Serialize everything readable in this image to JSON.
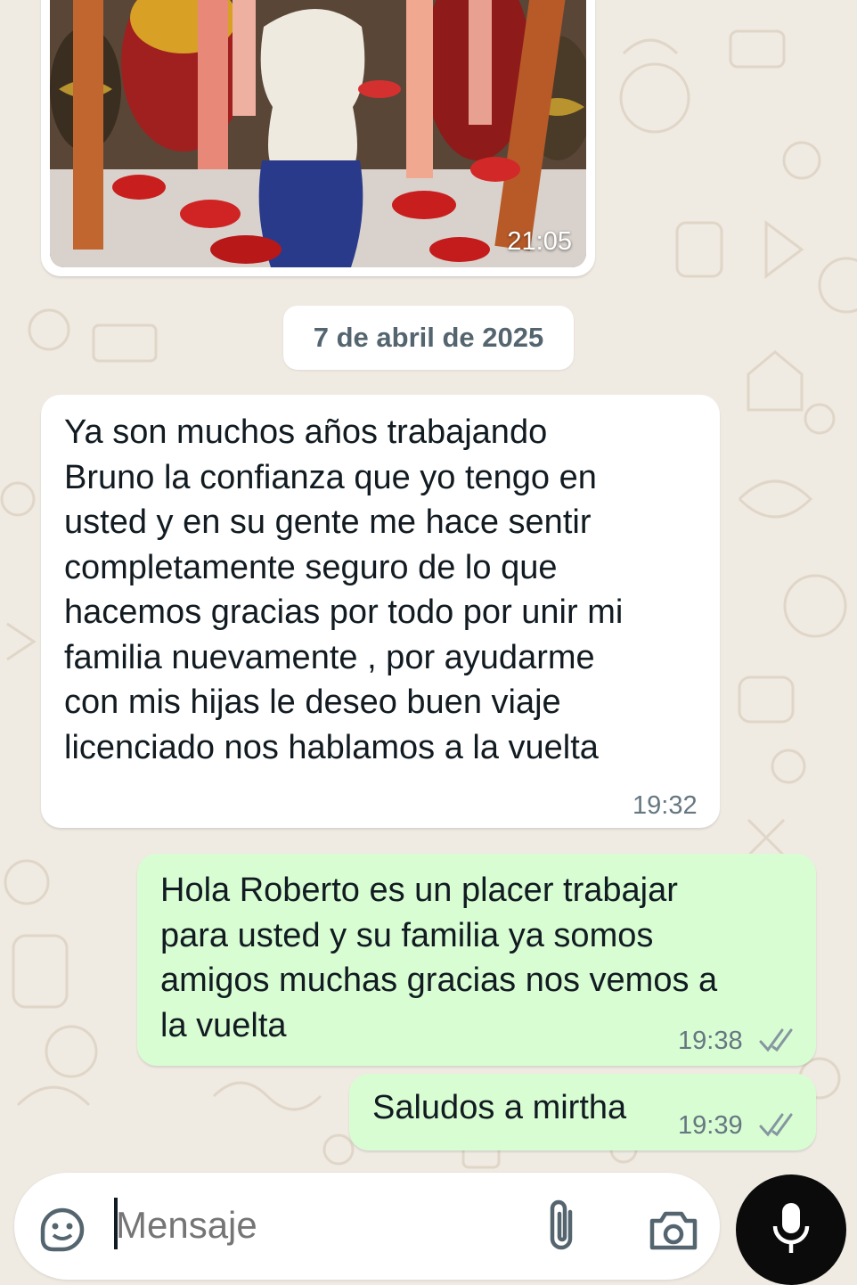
{
  "chat": {
    "image_message": {
      "time": "21:05"
    },
    "date_separator": "7 de abril de 2025",
    "messages": [
      {
        "direction": "incoming",
        "text": "Ya son muchos años trabajando\nBruno la confianza que yo tengo en\nusted y en su gente me hace sentir\ncompletamente seguro de lo que\nhacemos gracias por todo por unir mi\nfamilia nuevamente , por ayudarme\ncon mis hijas le deseo buen viaje\nlicenciado nos hablamos a la vuelta",
        "time": "19:32"
      },
      {
        "direction": "outgoing",
        "text": "Hola Roberto es un placer trabajar\npara usted y su familia ya somos\namigos muchas gracias nos vemos a\nla vuelta",
        "time": "19:38",
        "status": "delivered"
      },
      {
        "direction": "outgoing",
        "text": "Saludos a mirtha",
        "time": "19:39",
        "status": "delivered"
      }
    ]
  },
  "composer": {
    "placeholder": "Mensaje",
    "icons": [
      "sticker-icon",
      "attach-icon",
      "camera-icon",
      "mic-icon"
    ]
  },
  "colors": {
    "background": "#efeae2",
    "incoming_bubble": "#ffffff",
    "outgoing_bubble": "#d9fdd3",
    "timestamp": "#667781",
    "mic_button": "#0b0b0b"
  }
}
